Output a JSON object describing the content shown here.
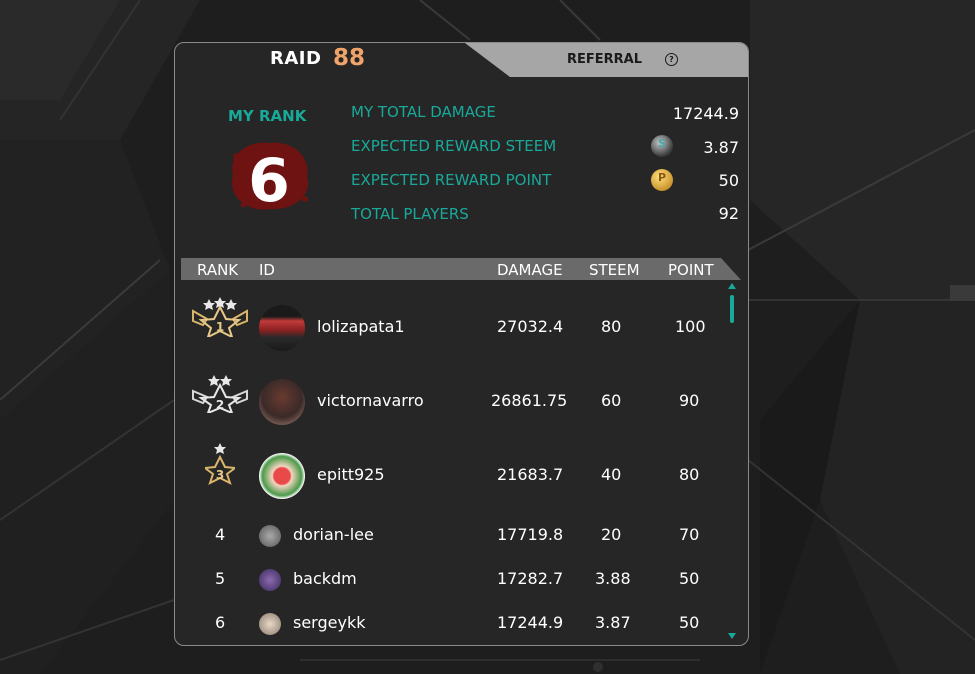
{
  "raid": {
    "label": "RAID",
    "number": "88"
  },
  "referral": {
    "label": "REFERRAL",
    "help_glyph": "?"
  },
  "my_rank": {
    "label": "MY RANK",
    "value": "6"
  },
  "stats": [
    {
      "label": "MY TOTAL DAMAGE",
      "value": "17244.9"
    },
    {
      "label": "EXPECTED REWARD STEEM",
      "value": "3.87",
      "icon": "steem-coin-icon"
    },
    {
      "label": "EXPECTED REWARD POINT",
      "value": "50",
      "icon": "point-coin-icon"
    },
    {
      "label": "TOTAL PLAYERS",
      "value": "92"
    }
  ],
  "table": {
    "headers": {
      "rank": "RANK",
      "id": "ID",
      "damage": "DAMAGE",
      "steem": "STEEM",
      "point": "POINT"
    },
    "rows": [
      {
        "rank": "1",
        "id": "lolizapata1",
        "damage": "27032.4",
        "steem": "80",
        "point": "100"
      },
      {
        "rank": "2",
        "id": "victornavarro",
        "damage": "26861.75",
        "steem": "60",
        "point": "90"
      },
      {
        "rank": "3",
        "id": "epitt925",
        "damage": "21683.7",
        "steem": "40",
        "point": "80"
      },
      {
        "rank": "4",
        "id": "dorian-lee",
        "damage": "17719.8",
        "steem": "20",
        "point": "70"
      },
      {
        "rank": "5",
        "id": "backdm",
        "damage": "17282.7",
        "steem": "3.88",
        "point": "50"
      },
      {
        "rank": "6",
        "id": "sergeykk",
        "damage": "17244.9",
        "steem": "3.87",
        "point": "50"
      }
    ]
  },
  "colors": {
    "accent": "#19a99a",
    "raid_number": "#f0a46a",
    "rank_blood": "#8b1a1a"
  }
}
